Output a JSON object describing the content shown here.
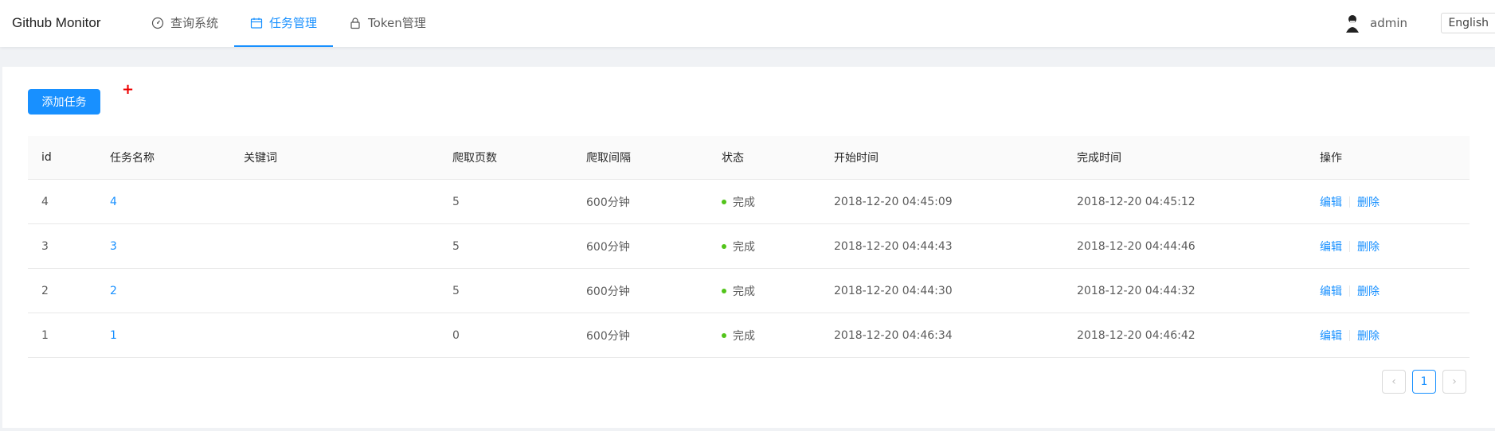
{
  "header": {
    "brand": "Github Monitor",
    "nav": [
      {
        "label": "查询系统",
        "icon": "dashboard-icon"
      },
      {
        "label": "任务管理",
        "icon": "calendar-icon",
        "active": true
      },
      {
        "label": "Token管理",
        "icon": "lock-icon"
      }
    ],
    "user": "admin",
    "language": "English"
  },
  "toolbar": {
    "add_label": "添加任务",
    "plus_mark": "+"
  },
  "table": {
    "columns": [
      "id",
      "任务名称",
      "关键词",
      "爬取页数",
      "爬取间隔",
      "状态",
      "开始时间",
      "完成时间",
      "操作"
    ],
    "rows": [
      {
        "id": "4",
        "name": "4",
        "keyword": "",
        "pages": "5",
        "interval": "600分钟",
        "status": "完成",
        "start": "2018-12-20 04:45:09",
        "end": "2018-12-20 04:45:12",
        "edit": "编辑",
        "delete": "删除"
      },
      {
        "id": "3",
        "name": "3",
        "keyword": "",
        "pages": "5",
        "interval": "600分钟",
        "status": "完成",
        "start": "2018-12-20 04:44:43",
        "end": "2018-12-20 04:44:46",
        "edit": "编辑",
        "delete": "删除"
      },
      {
        "id": "2",
        "name": "2",
        "keyword": "",
        "pages": "5",
        "interval": "600分钟",
        "status": "完成",
        "start": "2018-12-20 04:44:30",
        "end": "2018-12-20 04:44:32",
        "edit": "编辑",
        "delete": "删除"
      },
      {
        "id": "1",
        "name": "1",
        "keyword": "",
        "pages": "0",
        "interval": "600分钟",
        "status": "完成",
        "start": "2018-12-20 04:46:34",
        "end": "2018-12-20 04:46:42",
        "edit": "编辑",
        "delete": "删除"
      }
    ]
  },
  "pagination": {
    "prev": "‹",
    "current": "1",
    "next": "›"
  },
  "colors": {
    "accent": "#1890ff",
    "status_done": "#52c41a"
  }
}
